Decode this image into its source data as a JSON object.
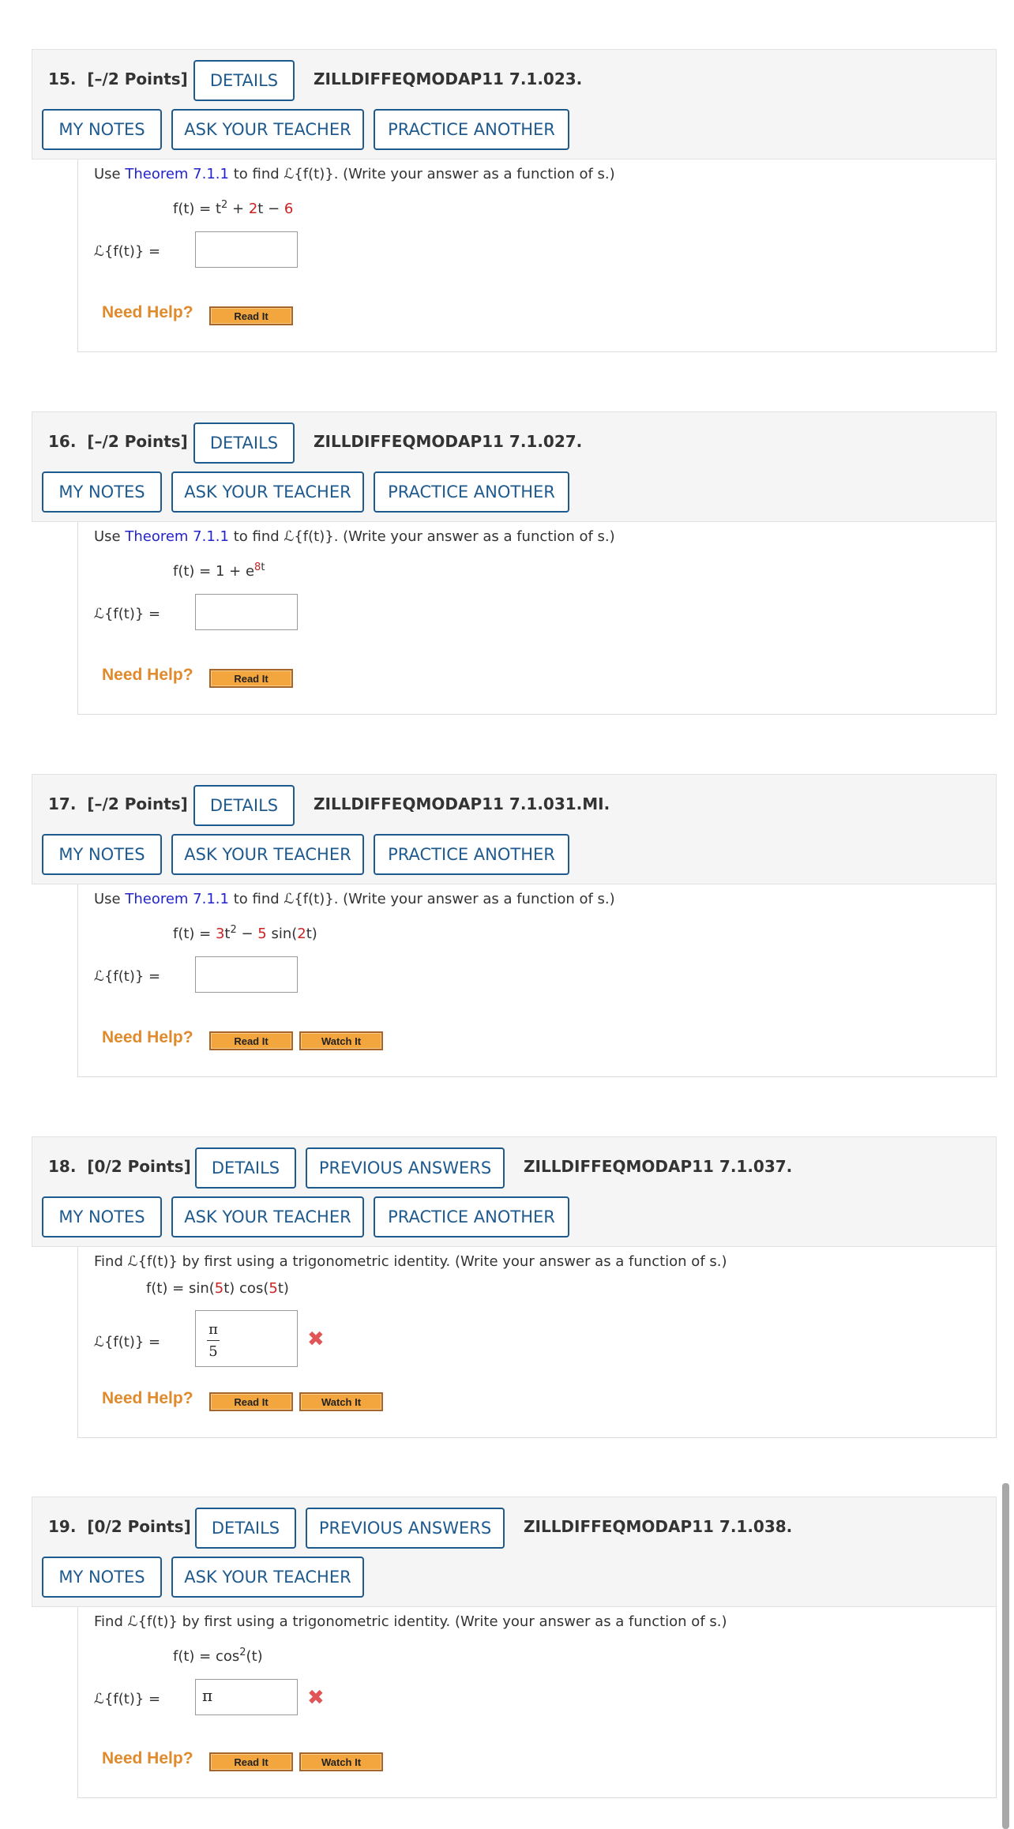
{
  "common": {
    "details": "DETAILS",
    "previous_answers": "PREVIOUS ANSWERS",
    "my_notes": "MY NOTES",
    "ask_teacher": "ASK YOUR TEACHER",
    "practice_another": "PRACTICE ANOTHER",
    "need_help": "Need Help?",
    "read_it": "Read It",
    "watch_it": "Watch It",
    "label": "ℒ{f(t)} ="
  },
  "questions": [
    {
      "num": "15.",
      "points": "[–/2 Points]",
      "id": "ZILLDIFFEQMODAP11 7.1.023.",
      "prompt_pre": "Use ",
      "prompt_link": "Theorem 7.1.1",
      "prompt_post": " to find ℒ{f(t)}. (Write your answer as a function of s.)",
      "f_lhs": "f(t) = t",
      "f_exp": "2",
      "f_a": " + ",
      "f_b": "2",
      "f_c": "t − ",
      "f_d": "6",
      "answer": ""
    },
    {
      "num": "16.",
      "points": "[–/2 Points]",
      "id": "ZILLDIFFEQMODAP11 7.1.027.",
      "prompt_pre": "Use ",
      "prompt_link": "Theorem 7.1.1",
      "prompt_post": " to find ℒ{f(t)}. (Write your answer as a function of s.)",
      "f_lhs": "f(t) = 1 + e",
      "f_exp_num": "8",
      "f_exp_var": "t",
      "answer": ""
    },
    {
      "num": "17.",
      "points": "[–/2 Points]",
      "id": "ZILLDIFFEQMODAP11 7.1.031.MI.",
      "prompt_pre": "Use ",
      "prompt_link": "Theorem 7.1.1",
      "prompt_post": " to find ℒ{f(t)}. (Write your answer as a function of s.)",
      "f_lhs": "f(t) = ",
      "f_a": "3",
      "f_b": "t",
      "f_exp": "2",
      "f_c": " − ",
      "f_d": "5",
      "f_e": " sin(",
      "f_f": "2",
      "f_g": "t)",
      "answer": ""
    },
    {
      "num": "18.",
      "points": "[0/2 Points]",
      "id": "ZILLDIFFEQMODAP11 7.1.037.",
      "prompt": "Find ℒ{f(t)} by first using a trigonometric identity. (Write your answer as a function of s.)",
      "f_lhs": "f(t) = sin(",
      "f_a": "5",
      "f_b": "t) cos(",
      "f_c": "5",
      "f_d": "t)",
      "answer_num": "π",
      "answer_den": "5"
    },
    {
      "num": "19.",
      "points": "[0/2 Points]",
      "id": "ZILLDIFFEQMODAP11 7.1.038.",
      "prompt": "Find ℒ{f(t)} by first using a trigonometric identity. (Write your answer as a function of s.)",
      "f_lhs": "f(t) = cos",
      "f_exp": "2",
      "f_rhs": "(t)",
      "answer": "π"
    }
  ]
}
